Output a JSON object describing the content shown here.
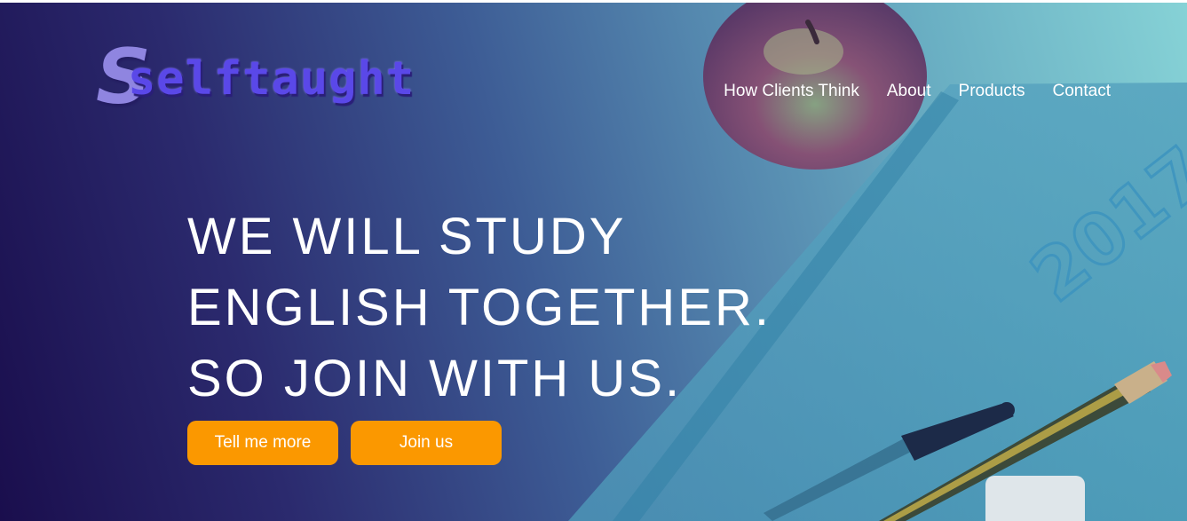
{
  "logo": {
    "initial": "S",
    "rest": "selftaught"
  },
  "nav": {
    "items": [
      {
        "label": "How Clients Think"
      },
      {
        "label": "About"
      },
      {
        "label": "Products"
      },
      {
        "label": "Contact"
      }
    ]
  },
  "hero": {
    "lines": [
      "WE WILL STUDY",
      "ENGLISH TOGETHER.",
      "SO JOIN WITH US."
    ],
    "buttons": {
      "primary_label": "Tell me more",
      "secondary_label": "Join us"
    },
    "notebook_year": "2017"
  },
  "colors": {
    "gradient_start": "#1a0e4d",
    "gradient_end": "#86d2d6",
    "button": "#fb9800",
    "logo_accent": "#5a48e8",
    "text": "#ffffff"
  }
}
